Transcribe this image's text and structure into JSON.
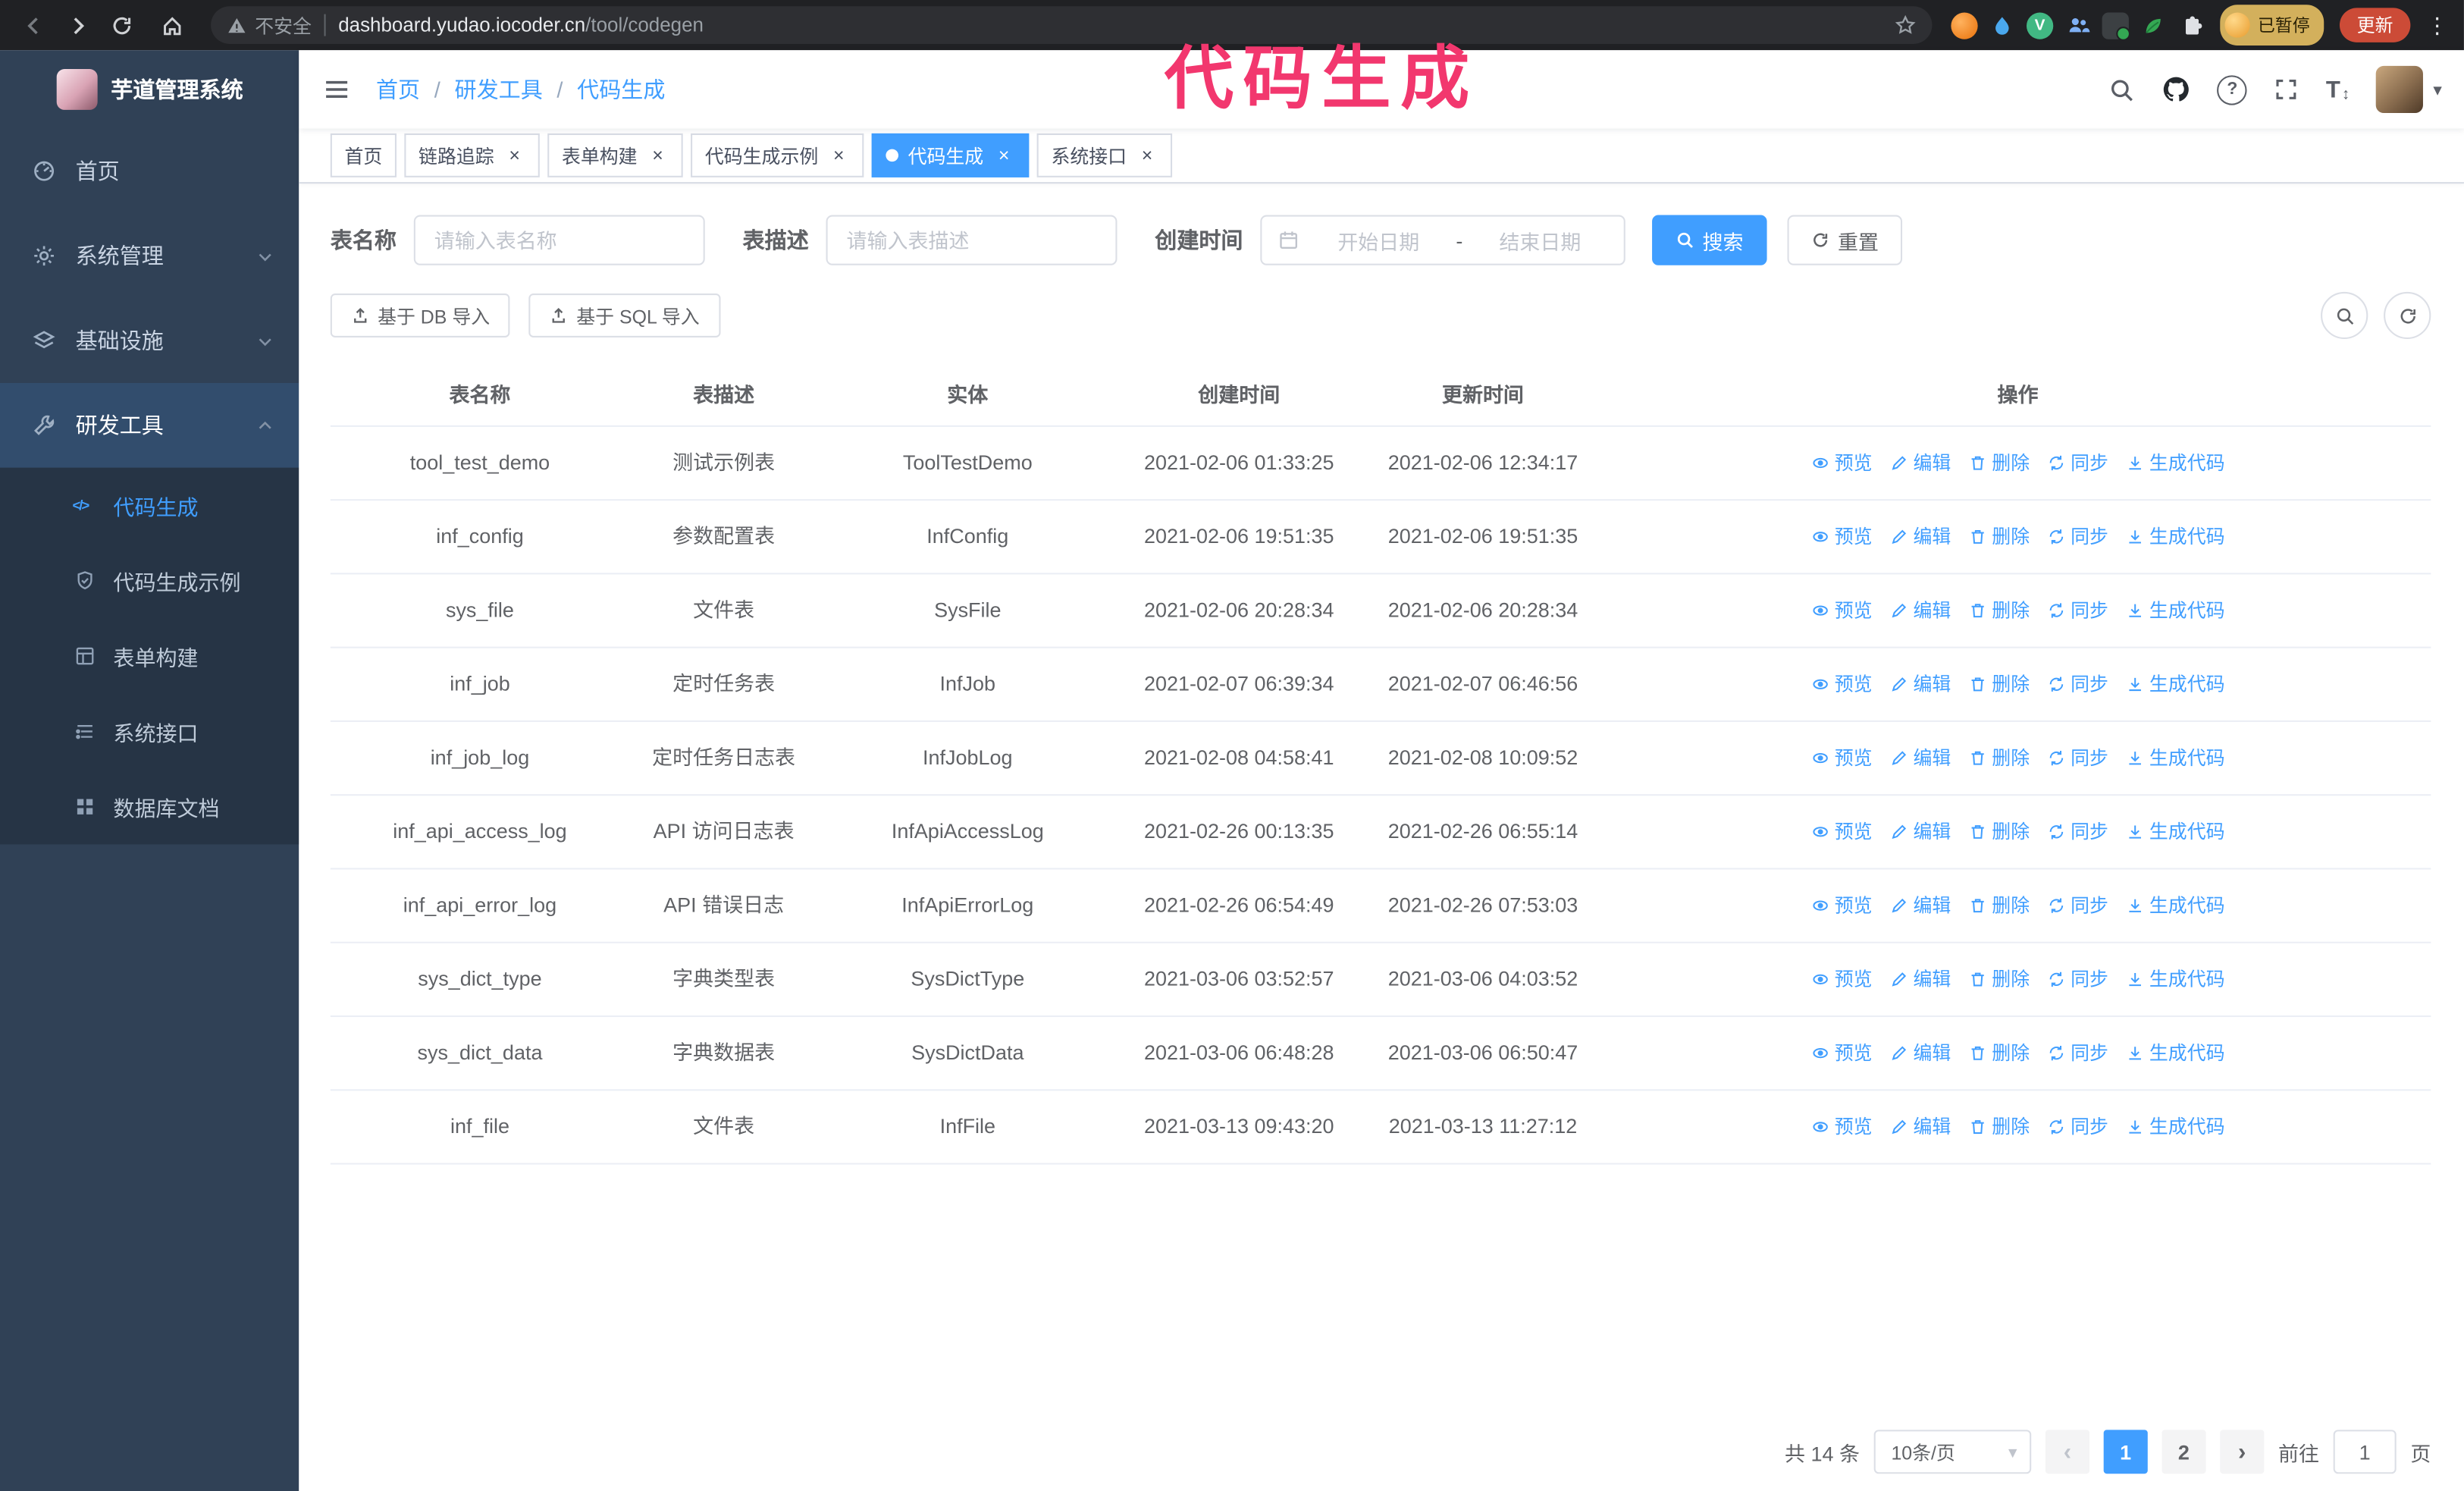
{
  "annotation": {
    "text": "代码生成",
    "color": "#f2376e"
  },
  "browser": {
    "insecure_label": "不安全",
    "url_host": "dashboard.yudao.iocoder.cn",
    "url_path": "/tool/codegen",
    "paused_badge": "已暂停",
    "update_button": "更新"
  },
  "sidebar": {
    "logo_title": "芋道管理系统",
    "items": [
      {
        "label": "首页"
      },
      {
        "label": "系统管理"
      },
      {
        "label": "基础设施"
      },
      {
        "label": "研发工具"
      }
    ],
    "subitems": [
      {
        "label": "代码生成",
        "active": true
      },
      {
        "label": "代码生成示例"
      },
      {
        "label": "表单构建"
      },
      {
        "label": "系统接口"
      },
      {
        "label": "数据库文档"
      }
    ]
  },
  "header": {
    "breadcrumb": [
      "首页",
      "研发工具",
      "代码生成"
    ]
  },
  "tabs": [
    {
      "label": "首页",
      "closable": false
    },
    {
      "label": "链路追踪",
      "closable": true
    },
    {
      "label": "表单构建",
      "closable": true
    },
    {
      "label": "代码生成示例",
      "closable": true
    },
    {
      "label": "代码生成",
      "closable": true,
      "active": true
    },
    {
      "label": "系统接口",
      "closable": true
    }
  ],
  "filters": {
    "table_name_label": "表名称",
    "table_name_placeholder": "请输入表名称",
    "table_desc_label": "表描述",
    "table_desc_placeholder": "请输入表描述",
    "create_time_label": "创建时间",
    "date_start_placeholder": "开始日期",
    "date_separator": "-",
    "date_end_placeholder": "结束日期",
    "search_button": "搜索",
    "reset_button": "重置"
  },
  "toolbar": {
    "import_db_button": "基于 DB 导入",
    "import_sql_button": "基于 SQL 导入"
  },
  "table": {
    "columns": [
      "表名称",
      "表描述",
      "实体",
      "创建时间",
      "更新时间",
      "操作"
    ],
    "actions": [
      "预览",
      "编辑",
      "删除",
      "同步",
      "生成代码"
    ],
    "rows": [
      {
        "name": "tool_test_demo",
        "desc": "测试示例表",
        "entity": "ToolTestDemo",
        "created": "2021-02-06 01:33:25",
        "updated": "2021-02-06 12:34:17"
      },
      {
        "name": "inf_config",
        "desc": "参数配置表",
        "entity": "InfConfig",
        "created": "2021-02-06 19:51:35",
        "updated": "2021-02-06 19:51:35"
      },
      {
        "name": "sys_file",
        "desc": "文件表",
        "entity": "SysFile",
        "created": "2021-02-06 20:28:34",
        "updated": "2021-02-06 20:28:34"
      },
      {
        "name": "inf_job",
        "desc": "定时任务表",
        "entity": "InfJob",
        "created": "2021-02-07 06:39:34",
        "updated": "2021-02-07 06:46:56"
      },
      {
        "name": "inf_job_log",
        "desc": "定时任务日志表",
        "entity": "InfJobLog",
        "created": "2021-02-08 04:58:41",
        "updated": "2021-02-08 10:09:52"
      },
      {
        "name": "inf_api_access_log",
        "desc": "API 访问日志表",
        "entity": "InfApiAccessLog",
        "created": "2021-02-26 00:13:35",
        "updated": "2021-02-26 06:55:14"
      },
      {
        "name": "inf_api_error_log",
        "desc": "API 错误日志",
        "entity": "InfApiErrorLog",
        "created": "2021-02-26 06:54:49",
        "updated": "2021-02-26 07:53:03"
      },
      {
        "name": "sys_dict_type",
        "desc": "字典类型表",
        "entity": "SysDictType",
        "created": "2021-03-06 03:52:57",
        "updated": "2021-03-06 04:03:52"
      },
      {
        "name": "sys_dict_data",
        "desc": "字典数据表",
        "entity": "SysDictData",
        "created": "2021-03-06 06:48:28",
        "updated": "2021-03-06 06:50:47"
      },
      {
        "name": "inf_file",
        "desc": "文件表",
        "entity": "InfFile",
        "created": "2021-03-13 09:43:20",
        "updated": "2021-03-13 11:27:12"
      }
    ]
  },
  "pagination": {
    "total_text": "共 14 条",
    "page_size": "10条/页",
    "pages": [
      "1",
      "2"
    ],
    "active_page": "1",
    "goto_label": "前往",
    "goto_value": "1",
    "goto_suffix": "页"
  },
  "icons": {
    "close": "×",
    "caret_down": "▾",
    "prev_arrow": "‹",
    "next_arrow": "›",
    "kebab": "⋮",
    "help": "?",
    "code": "</>",
    "text_size": "T",
    "updown": "↕",
    "vue": "V"
  }
}
